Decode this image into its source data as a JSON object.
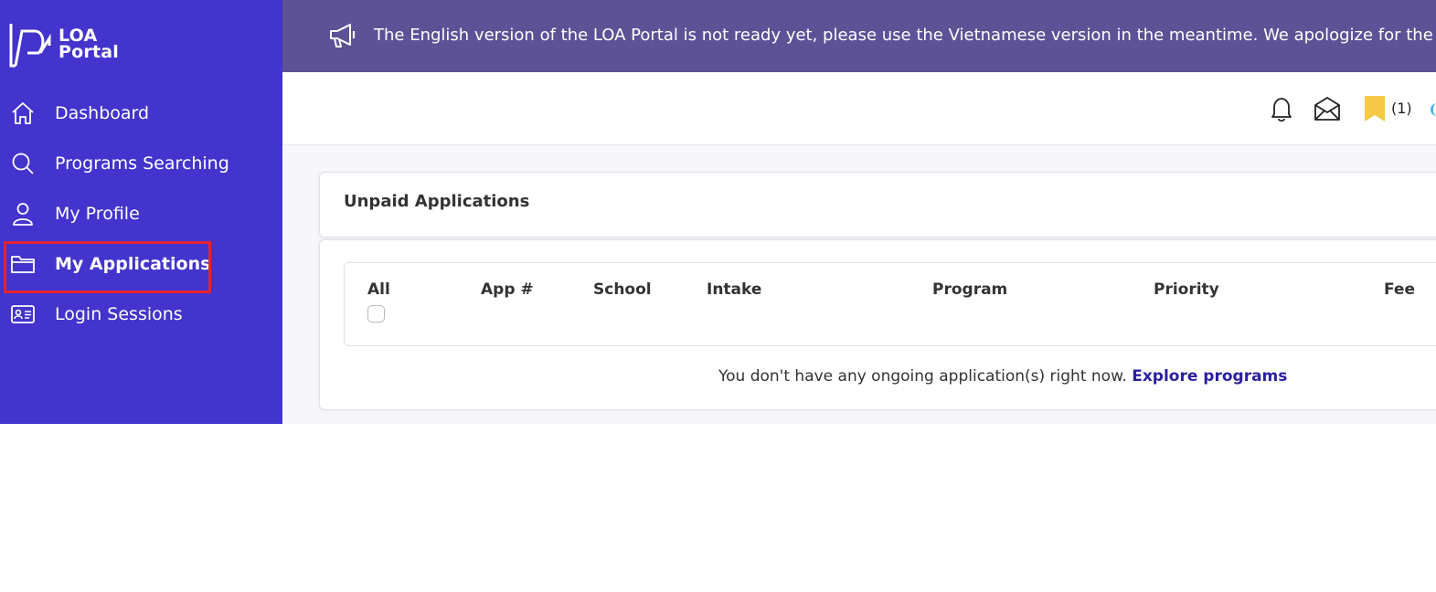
{
  "brand": {
    "line1": "LOA",
    "line2": "Portal"
  },
  "sidebar": {
    "items": [
      {
        "label": "Dashboard",
        "icon": "home-icon"
      },
      {
        "label": "Programs Searching",
        "icon": "search-icon"
      },
      {
        "label": "My Profile",
        "icon": "user-icon"
      },
      {
        "label": "My Applications",
        "icon": "folder-icon",
        "active": true
      },
      {
        "label": "Login Sessions",
        "icon": "id-card-icon"
      }
    ]
  },
  "banner": {
    "icon": "megaphone-icon",
    "text": "The English version of the LOA Portal is not ready yet, please use the Vietnamese version in the meantime. We apologize for the inco"
  },
  "topbar": {
    "icons": [
      "bell-icon",
      "envelope-open-icon",
      "bookmark-icon"
    ],
    "bookmark_count": "(1)"
  },
  "unpaid": {
    "title": "Unpaid Applications",
    "columns": [
      "All",
      "App #",
      "School",
      "Intake",
      "Program",
      "Priority",
      "Fee"
    ],
    "empty_text": "You don't have any ongoing application(s) right now. ",
    "empty_link": "Explore programs"
  },
  "colors": {
    "sidebar": "#4234cc",
    "banner": "#5d5296",
    "highlight": "#e8232f",
    "bookmark": "#f7c948",
    "link": "#2b1fa0"
  }
}
